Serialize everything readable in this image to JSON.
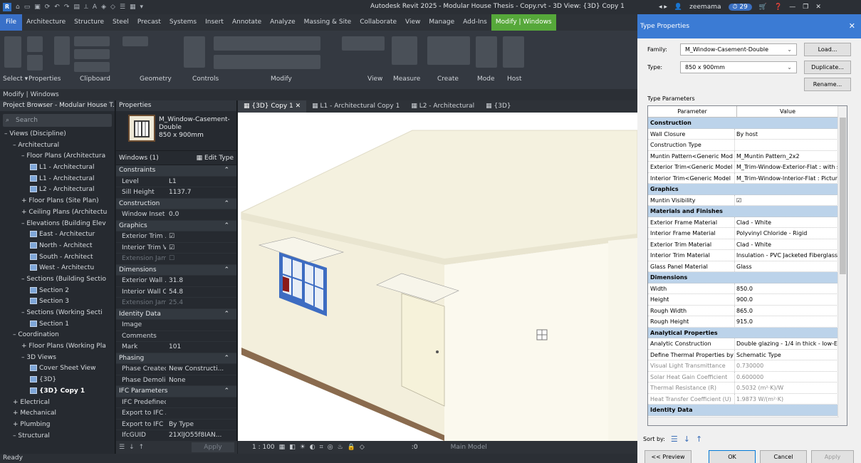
{
  "window": {
    "title": "Autodesk Revit 2025 - Modular House Thesis - Copy.rvt - 3D View: {3D} Copy 1",
    "user": "zeemama",
    "notifications": "29"
  },
  "menu": [
    "File",
    "Architecture",
    "Structure",
    "Steel",
    "Precast",
    "Systems",
    "Insert",
    "Annotate",
    "Analyze",
    "Massing & Site",
    "Collaborate",
    "View",
    "Manage",
    "Add-Ins",
    "Modify | Windows"
  ],
  "ribbon": {
    "groups": [
      "Select ▾",
      "Properties",
      "Clipboard",
      "Geometry",
      "Controls",
      "Modify",
      "View",
      "Measure",
      "Create",
      "Mode",
      "Host"
    ],
    "context": "Modify | Windows"
  },
  "project_browser": {
    "header": "Project Browser - Modular House T...",
    "search_placeholder": "Search",
    "items": [
      {
        "label": "– Views (Discipline)",
        "indent": 0
      },
      {
        "label": "– Architectural",
        "indent": 1
      },
      {
        "label": "– Floor Plans (Architectura",
        "indent": 2
      },
      {
        "label": "L1 - Architectural",
        "indent": 3,
        "icon": true
      },
      {
        "label": "L1 - Architectural",
        "indent": 3,
        "icon": true
      },
      {
        "label": "L2 - Architectural",
        "indent": 3,
        "icon": true
      },
      {
        "label": "+ Floor Plans (Site Plan)",
        "indent": 2
      },
      {
        "label": "+ Ceiling Plans (Architectu",
        "indent": 2
      },
      {
        "label": "– Elevations (Building Elev",
        "indent": 2
      },
      {
        "label": "East - Architectur",
        "indent": 3,
        "icon": true
      },
      {
        "label": "North - Architect",
        "indent": 3,
        "icon": true
      },
      {
        "label": "South - Architect",
        "indent": 3,
        "icon": true
      },
      {
        "label": "West - Architectu",
        "indent": 3,
        "icon": true
      },
      {
        "label": "– Sections (Building Sectio",
        "indent": 2
      },
      {
        "label": "Section 2",
        "indent": 3,
        "icon": true
      },
      {
        "label": "Section 3",
        "indent": 3,
        "icon": true
      },
      {
        "label": "– Sections (Working Secti",
        "indent": 2
      },
      {
        "label": "Section 1",
        "indent": 3,
        "icon": true
      },
      {
        "label": "– Coordination",
        "indent": 1
      },
      {
        "label": "+ Floor Plans (Working Pla",
        "indent": 2
      },
      {
        "label": "– 3D Views",
        "indent": 2
      },
      {
        "label": "Cover Sheet View",
        "indent": 3,
        "icon": true
      },
      {
        "label": "{3D}",
        "indent": 3,
        "icon": true
      },
      {
        "label": "{3D} Copy 1",
        "indent": 3,
        "icon": true,
        "selected": true
      },
      {
        "label": "+ Electrical",
        "indent": 1
      },
      {
        "label": "+ Mechanical",
        "indent": 1
      },
      {
        "label": "+ Plumbing",
        "indent": 1
      },
      {
        "label": "– Structural",
        "indent": 1
      }
    ]
  },
  "properties": {
    "header": "Properties",
    "type_name": "M_Window-Casement-Double",
    "type_size": "850 x 900mm",
    "filter": "Windows (1)",
    "edit_type": "Edit Type",
    "apply": "Apply",
    "rows": [
      {
        "sec": "Constraints"
      },
      {
        "k": "Level",
        "v": "L1"
      },
      {
        "k": "Sill Height",
        "v": "1137.7"
      },
      {
        "sec": "Construction"
      },
      {
        "k": "Window Inset",
        "v": "0.0"
      },
      {
        "sec": "Graphics"
      },
      {
        "k": "Exterior Trim ...",
        "v": "☑"
      },
      {
        "k": "Interior Trim V...",
        "v": "☑"
      },
      {
        "k": "Extension Jam...",
        "v": "☐",
        "dim": true
      },
      {
        "sec": "Dimensions"
      },
      {
        "k": "Exterior Wall ...",
        "v": "31.8"
      },
      {
        "k": "Interior Wall C...",
        "v": "54.8"
      },
      {
        "k": "Extension Jamb",
        "v": "25.4",
        "dim": true
      },
      {
        "sec": "Identity Data"
      },
      {
        "k": "Image",
        "v": ""
      },
      {
        "k": "Comments",
        "v": ""
      },
      {
        "k": "Mark",
        "v": "101"
      },
      {
        "sec": "Phasing"
      },
      {
        "k": "Phase Created",
        "v": "New Constructi..."
      },
      {
        "k": "Phase Demoli...",
        "v": "None"
      },
      {
        "sec": "IFC Parameters"
      },
      {
        "k": "IFC Predefined...",
        "v": ""
      },
      {
        "k": "Export to IFC As",
        "v": ""
      },
      {
        "k": "Export to IFC",
        "v": "By Type"
      },
      {
        "k": "IfcGUID",
        "v": "21XlJO55f8IAN..."
      }
    ]
  },
  "view_tabs": [
    {
      "label": "{3D} Copy 1",
      "active": true
    },
    {
      "label": "L1 - Architectural Copy 1"
    },
    {
      "label": "L2 - Architectural"
    },
    {
      "label": "{3D}"
    }
  ],
  "view_bar": {
    "scale": "1 : 100",
    "model": "Main Model",
    "zero": ":0"
  },
  "status": "Ready",
  "colors": {
    "accent": "#3970c8",
    "context_tab": "#56a83a",
    "dialog_title": "#3b7bd4",
    "section_row": "#bcd3ea"
  },
  "dialog": {
    "title": "Type Properties",
    "family_label": "Family:",
    "family_value": "M_Window-Casement-Double",
    "type_label": "Type:",
    "type_value": "850 x 900mm",
    "load": "Load...",
    "duplicate": "Duplicate...",
    "rename": "Rename...",
    "type_params": "Type Parameters",
    "col_param": "Parameter",
    "col_value": "Value",
    "rows": [
      {
        "sec": "Construction"
      },
      {
        "k": "Wall Closure",
        "v": "By host"
      },
      {
        "k": "Construction Type",
        "v": ""
      },
      {
        "k": "Muntin Pattern<Generic Mod",
        "v": "M_Muntin Pattern_2x2"
      },
      {
        "k": "Exterior Trim<Generic Model",
        "v": "M_Trim-Window-Exterior-Flat : with s"
      },
      {
        "k": "Interior Trim<Generic Model",
        "v": "M_Trim-Window-Interior-Flat : Pictur"
      },
      {
        "sec": "Graphics"
      },
      {
        "k": "Muntin Visibility",
        "v": "☑"
      },
      {
        "sec": "Materials and Finishes"
      },
      {
        "k": "Exterior Frame Material",
        "v": "Clad - White"
      },
      {
        "k": "Interior Frame Material",
        "v": "Polyvinyl Chloride - Rigid"
      },
      {
        "k": "Exterior Trim Material",
        "v": "Clad - White"
      },
      {
        "k": "Interior Trim Material",
        "v": "Insulation - PVC Jacketed Fiberglass"
      },
      {
        "k": "Glass Panel Material",
        "v": "Glass"
      },
      {
        "sec": "Dimensions"
      },
      {
        "k": "Width",
        "v": "850.0"
      },
      {
        "k": "Height",
        "v": "900.0"
      },
      {
        "k": "Rough Width",
        "v": "865.0"
      },
      {
        "k": "Rough Height",
        "v": "915.0"
      },
      {
        "sec": "Analytical Properties"
      },
      {
        "k": "Analytic Construction",
        "v": "Double glazing - 1/4 in thick - low-E"
      },
      {
        "k": "Define Thermal Properties by",
        "v": "Schematic Type"
      },
      {
        "k": "Visual Light Transmittance",
        "v": "0.730000",
        "dim": true
      },
      {
        "k": "Solar Heat Gain Coefficient",
        "v": "0.600000",
        "dim": true
      },
      {
        "k": "Thermal Resistance (R)",
        "v": "0.5032 (m²·K)/W",
        "dim": true
      },
      {
        "k": "Heat Transfer Coefficient (U)",
        "v": "1.9873 W/(m²·K)",
        "dim": true
      },
      {
        "sec": "Identity Data"
      }
    ],
    "sort_label": "Sort by:",
    "preview": "<< Preview",
    "ok": "OK",
    "cancel": "Cancel",
    "apply": "Apply"
  }
}
